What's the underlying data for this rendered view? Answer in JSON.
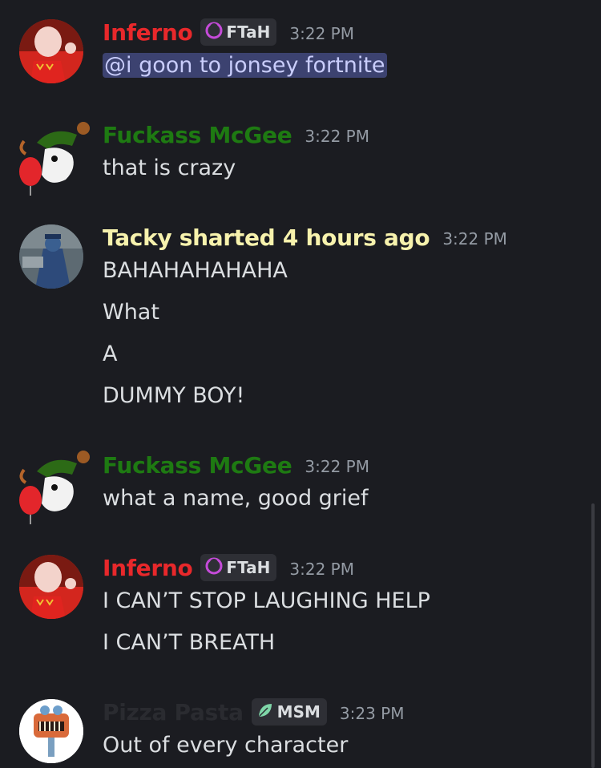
{
  "colors": {
    "background": "#1b1c21",
    "text": "#dbdee1",
    "muted": "#949ba4",
    "inferno": "#e8282b",
    "fuckass": "#1e7a12",
    "tacky": "#f7f2ad",
    "pizza": "#2a2b30",
    "mention_bg": "#3c4270",
    "tag_bg": "#2e2f35"
  },
  "messages": [
    {
      "username": "Inferno",
      "tag": "FTaH",
      "tag_icon": "purple-moon-icon",
      "time": "3:22 PM",
      "mention": "@i goon to jonsey fortnite"
    },
    {
      "username": "Fuckass McGee",
      "time": "3:22 PM",
      "lines": [
        "that is crazy"
      ]
    },
    {
      "username": "Tacky sharted 4 hours ago",
      "time": "3:22 PM",
      "lines": [
        "BAHAHAHAHAHA",
        "What",
        "A",
        "DUMMY BOY!"
      ]
    },
    {
      "username": "Fuckass McGee",
      "time": "3:22 PM",
      "lines": [
        "what a name, good grief"
      ]
    },
    {
      "username": "Inferno",
      "tag": "FTaH",
      "tag_icon": "purple-moon-icon",
      "time": "3:22 PM",
      "lines": [
        "I CAN’T STOP LAUGHING HELP",
        "I CAN’T BREATH"
      ]
    },
    {
      "username": "Pizza Pasta",
      "tag": "MSM",
      "tag_icon": "green-leaf-icon",
      "time": "3:23 PM",
      "lines": [
        "Out of every character"
      ]
    }
  ]
}
